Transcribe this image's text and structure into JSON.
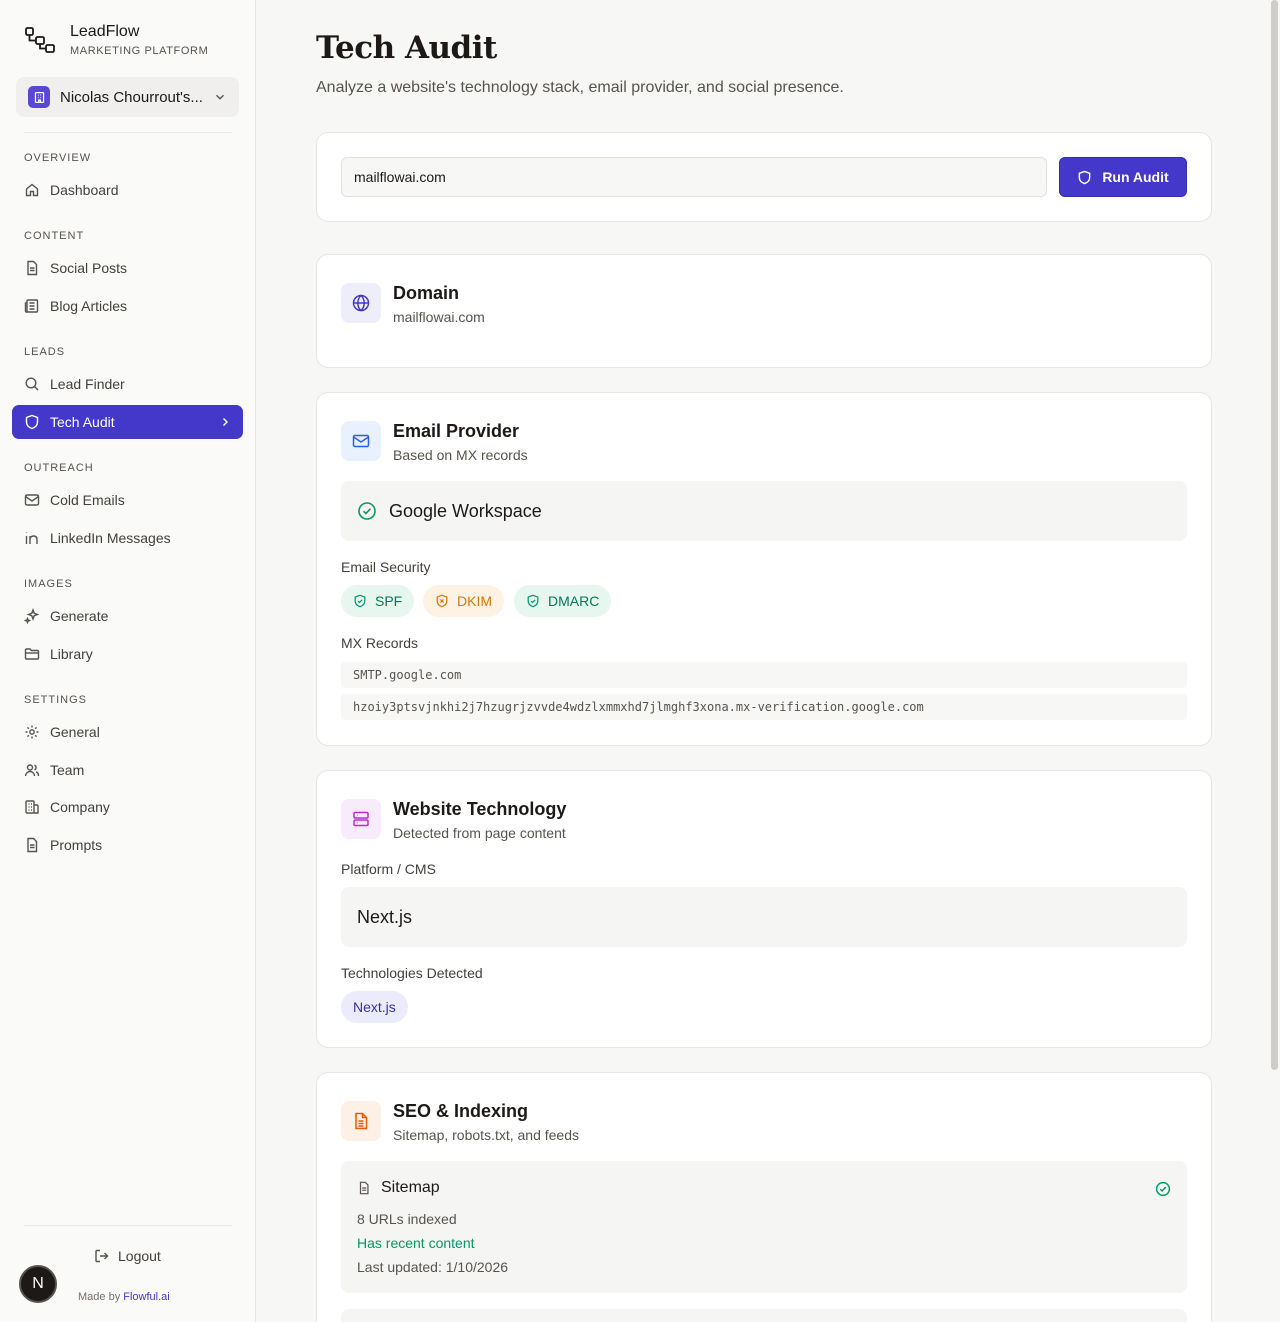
{
  "brand": {
    "title": "LeadFlow",
    "subtitle": "MARKETING PLATFORM"
  },
  "workspace": {
    "name": "Nicolas Chourrout's..."
  },
  "nav": {
    "overview_label": "OVERVIEW",
    "dashboard": "Dashboard",
    "content_label": "CONTENT",
    "social_posts": "Social Posts",
    "blog_articles": "Blog Articles",
    "leads_label": "LEADS",
    "lead_finder": "Lead Finder",
    "tech_audit": "Tech Audit",
    "outreach_label": "OUTREACH",
    "cold_emails": "Cold Emails",
    "linkedin_messages": "LinkedIn Messages",
    "images_label": "IMAGES",
    "generate": "Generate",
    "library": "Library",
    "settings_label": "SETTINGS",
    "general": "General",
    "team": "Team",
    "company": "Company",
    "prompts": "Prompts"
  },
  "footer": {
    "logout": "Logout",
    "made_by": "Made by",
    "made_by_link": "Flowful.ai",
    "avatar_initial": "N"
  },
  "page": {
    "title": "Tech Audit",
    "subtitle": "Analyze a website's technology stack, email provider, and social presence."
  },
  "audit_form": {
    "input_value": "mailflowai.com",
    "run_label": "Run Audit"
  },
  "domain": {
    "title": "Domain",
    "value": "mailflowai.com"
  },
  "email_provider": {
    "title": "Email Provider",
    "subtitle": "Based on MX records",
    "provider": "Google Workspace",
    "security_label": "Email Security",
    "badges": [
      {
        "label": "SPF",
        "status": "pass"
      },
      {
        "label": "DKIM",
        "status": "warn"
      },
      {
        "label": "DMARC",
        "status": "pass"
      }
    ],
    "mx_label": "MX Records",
    "mx_records": [
      "SMTP.google.com",
      "hzoiy3ptsvjnkhi2j7hzugrjzvvde4wdzlxmmxhd7jlmghf3xona.mx-verification.google.com"
    ]
  },
  "website_tech": {
    "title": "Website Technology",
    "subtitle": "Detected from page content",
    "platform_label": "Platform / CMS",
    "platform": "Next.js",
    "tech_label": "Technologies Detected",
    "technologies": [
      "Next.js"
    ]
  },
  "seo": {
    "title": "SEO & Indexing",
    "subtitle": "Sitemap, robots.txt, and feeds",
    "sitemap_title": "Sitemap",
    "urls_indexed": "8 URLs indexed",
    "recent_content": "Has recent content",
    "last_updated": "Last updated: 1/10/2026"
  },
  "colors": {
    "accent": "#4338ca",
    "success": "#059669",
    "warning": "#d97706"
  }
}
